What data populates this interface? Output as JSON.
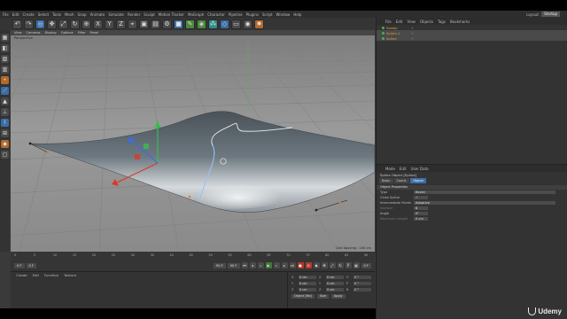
{
  "menubar": {
    "items": [
      "File",
      "Edit",
      "Create",
      "Select",
      "Tools",
      "Mesh",
      "Snap",
      "Animate",
      "Simulate",
      "Render",
      "Sculpt",
      "Motion Tracker",
      "MoGraph",
      "Character",
      "Pipeline",
      "Plugins",
      "Script",
      "Window",
      "Help"
    ],
    "layout_label": "Layout:",
    "layout_value": "Startup"
  },
  "viewport": {
    "menu": [
      "View",
      "Cameras",
      "Display",
      "Options",
      "Filter",
      "Panel"
    ],
    "label": "Perspective",
    "grid_spacing": "Grid Spacing : 100 cm"
  },
  "object_manager": {
    "menu": [
      "File",
      "Edit",
      "View",
      "Objects",
      "Tags",
      "Bookmarks"
    ],
    "objects": [
      {
        "name": "Sweep"
      },
      {
        "name": "Spline.1"
      },
      {
        "name": "Spline"
      }
    ]
  },
  "attribute_manager": {
    "menu": [
      "Mode",
      "Edit",
      "User Data"
    ],
    "title": "Spline Object [Spline]",
    "tabs": [
      "Basic",
      "Coord.",
      "Object"
    ],
    "active_tab": "Object",
    "section": "Object Properties",
    "rows": [
      {
        "label": "Type",
        "value": "Bezier"
      },
      {
        "label": "Close Spline",
        "value": "✓"
      },
      {
        "label": "Intermediate Points",
        "value": "Adaptive"
      },
      {
        "label": "Number",
        "value": "8"
      },
      {
        "label": "Angle",
        "value": "5°"
      },
      {
        "label": "Maximum Length",
        "value": "5 cm"
      }
    ]
  },
  "timeline": {
    "ticks": [
      "0",
      "5",
      "10",
      "15",
      "20",
      "25",
      "30",
      "35",
      "40",
      "45",
      "50",
      "55",
      "60",
      "65",
      "70",
      "75",
      "80",
      "85",
      "90"
    ],
    "current_frame": "0 F",
    "start_frame": "0 F",
    "end_frame": "90 F",
    "end_frame_2": "90 F",
    "right_frame": "0 F"
  },
  "material_panel": {
    "menu": [
      "Create",
      "Edit",
      "Function",
      "Texture"
    ]
  },
  "coordinates": {
    "rows": [
      {
        "a": "X",
        "av": "0 cm",
        "b": "X",
        "bv": "0 cm",
        "c": "H",
        "cv": "0 °"
      },
      {
        "a": "Y",
        "av": "0 cm",
        "b": "Y",
        "bv": "0 cm",
        "c": "P",
        "cv": "0 °"
      },
      {
        "a": "Z",
        "av": "0 cm",
        "b": "Z",
        "bv": "0 cm",
        "c": "B",
        "cv": "0 °"
      }
    ],
    "mode": "Object (Rel)",
    "size_mode": "Size",
    "apply": "Apply"
  },
  "watermark": "Udemy",
  "colors": {
    "accent_blue": "#3a6ea8",
    "object_orange": "#e0a030",
    "check_green": "#5ad35a",
    "viewport_bg": "#8e8e8e"
  }
}
